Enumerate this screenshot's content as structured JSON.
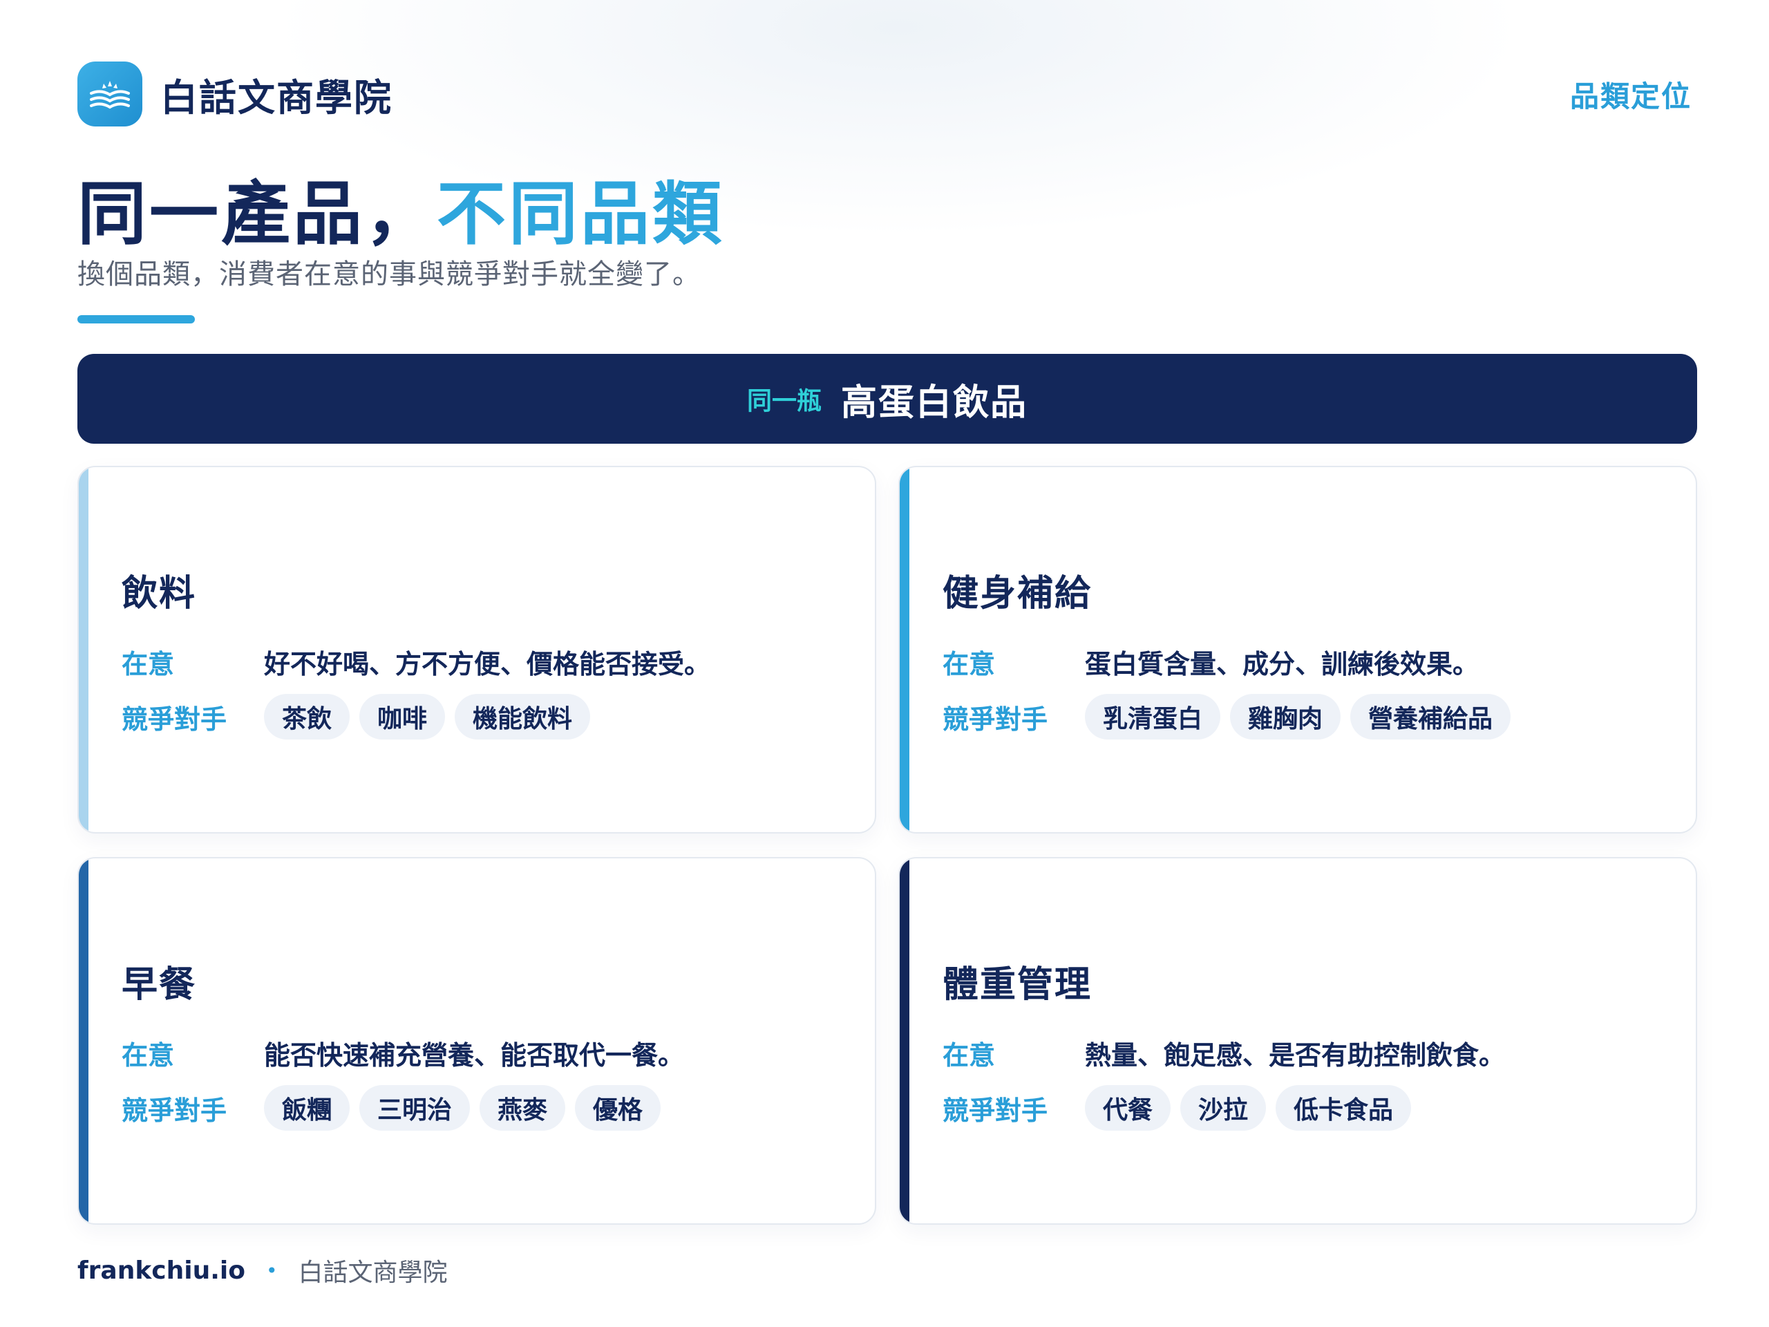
{
  "header": {
    "brand_name": "白話文商學院",
    "tag": "品類定位"
  },
  "title": {
    "part1": "同一產品，",
    "part2": "不同品類"
  },
  "subtitle": "換個品類，消費者在意的事與競爭對手就全變了。",
  "banner": {
    "kicker": "同一瓶",
    "product": "高蛋白飲品"
  },
  "labels": {
    "care": "在意",
    "competitors": "競爭對手"
  },
  "cards": [
    {
      "title": "飲料",
      "care": "好不好喝、方不方便、價格能否接受。",
      "competitors": [
        "茶飲",
        "咖啡",
        "機能飲料"
      ],
      "accent": "#a9d4ee"
    },
    {
      "title": "健身補給",
      "care": "蛋白質含量、成分、訓練後效果。",
      "competitors": [
        "乳清蛋白",
        "雞胸肉",
        "營養補給品"
      ],
      "accent": "#2ea6dd"
    },
    {
      "title": "早餐",
      "care": "能否快速補充營養、能否取代一餐。",
      "competitors": [
        "飯糰",
        "三明治",
        "燕麥",
        "優格"
      ],
      "accent": "#2366a8"
    },
    {
      "title": "體重管理",
      "care": "熱量、飽足感、是否有助控制飲食。",
      "competitors": [
        "代餐",
        "沙拉",
        "低卡食品"
      ],
      "accent": "#13275a"
    }
  ],
  "footer": {
    "site": "frankchiu.io",
    "separator": "•",
    "name": "白話文商學院"
  }
}
